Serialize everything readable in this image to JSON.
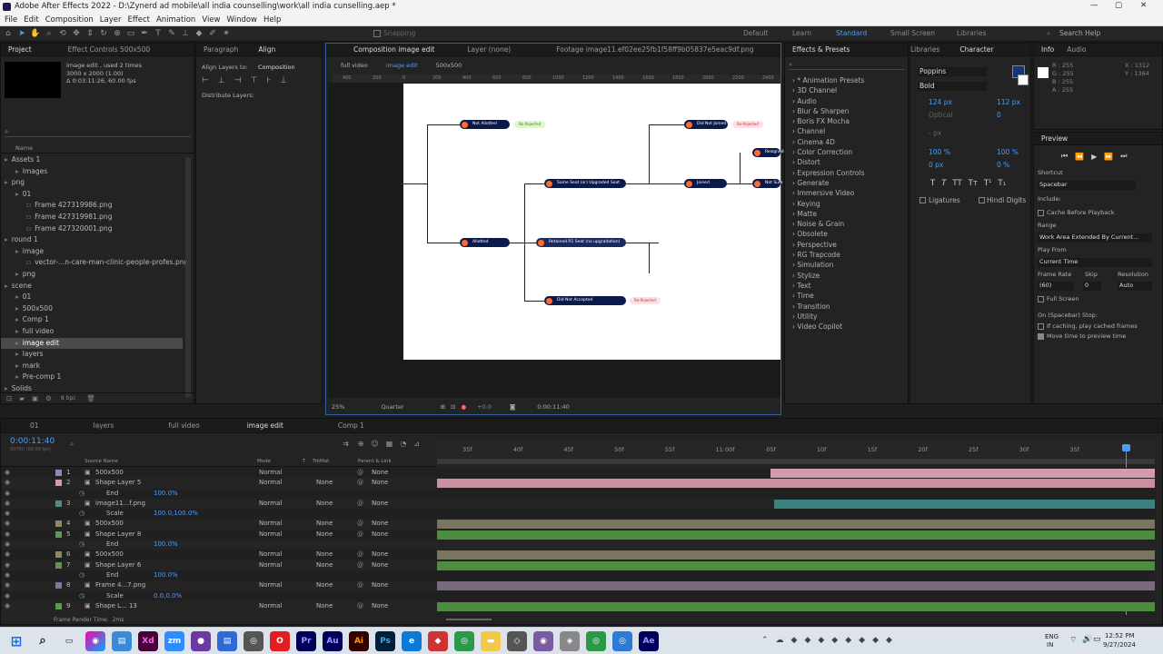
{
  "window": {
    "title": "Adobe After Effects 2022 - D:\\Zynerd ad mobile\\all india counselling\\work\\all india cunselling.aep *"
  },
  "menu": [
    "File",
    "Edit",
    "Composition",
    "Layer",
    "Effect",
    "Animation",
    "View",
    "Window",
    "Help"
  ],
  "toolbar": {
    "snapping": "Snapping",
    "workspaces": [
      "Default",
      "Learn",
      "Standard",
      "Small Screen",
      "Libraries"
    ],
    "search": "Search Help"
  },
  "project": {
    "tabs": [
      "Project",
      "Effect Controls 500x500"
    ],
    "info": [
      "image edit , used 2 times",
      "3000 x 2000 (1.00)",
      "Δ 0:03:11:26, 60.00 fps"
    ],
    "column": "Name",
    "items": [
      {
        "label": "Assets 1",
        "depth": 0
      },
      {
        "label": "Images",
        "depth": 1
      },
      {
        "label": "png",
        "depth": 0
      },
      {
        "label": "01",
        "depth": 1
      },
      {
        "label": "Frame 427319986.png",
        "depth": 2
      },
      {
        "label": "Frame 427319981.png",
        "depth": 2
      },
      {
        "label": "Frame 427320001.png",
        "depth": 2
      },
      {
        "label": "round 1",
        "depth": 0
      },
      {
        "label": "image",
        "depth": 1
      },
      {
        "label": "vector-...n-care-man-clinic-people-profes.png",
        "depth": 2
      },
      {
        "label": "png",
        "depth": 1
      },
      {
        "label": "scene",
        "depth": 0
      },
      {
        "label": "01",
        "depth": 1
      },
      {
        "label": "500x500",
        "depth": 1
      },
      {
        "label": "Comp 1",
        "depth": 1
      },
      {
        "label": "full video",
        "depth": 1
      },
      {
        "label": "image edit",
        "depth": 1,
        "selected": true
      },
      {
        "label": "layers",
        "depth": 1
      },
      {
        "label": "mark",
        "depth": 1
      },
      {
        "label": "Pre-comp 1",
        "depth": 1
      },
      {
        "label": "Solids",
        "depth": 0
      }
    ],
    "bpc": "8 bpc"
  },
  "align": {
    "tabs": [
      "Paragraph",
      "Align"
    ],
    "align_to_label": "Align Layers to:",
    "align_to_value": "Composition",
    "distribute_label": "Distribute Layers:"
  },
  "composition": {
    "tabs": [
      "Composition image edit",
      "Layer (none)",
      "Footage image11.ef02ee25fb1f58ff9b05837e5eac9df.png"
    ],
    "breadcrumbs": [
      "full video",
      "image edit",
      "500x500"
    ],
    "ruler": [
      "400",
      "200",
      "0",
      "200",
      "400",
      "600",
      "800",
      "1000",
      "1200",
      "1400",
      "1600",
      "1800",
      "2000",
      "2200",
      "2400"
    ],
    "zoom": "25%",
    "resolution": "Quarter",
    "exposure": "+0.0",
    "timecode": "0:00:11:40",
    "nodes": [
      "Not Allotted",
      "No Rejected",
      "Did Not Joined",
      "Re-Rejected",
      "Resigned",
      "Not Sure",
      "Joined",
      "Same Seat (or) Upgraded Seat",
      "Allotted",
      "Retained R1 Seat (no upgradation)",
      "Did Not Accepted",
      "Re-Rejected"
    ]
  },
  "effects": {
    "title": "Effects & Presets",
    "items": [
      "* Animation Presets",
      "3D Channel",
      "Audio",
      "Blur & Sharpen",
      "Boris FX Mocha",
      "Channel",
      "Cinema 4D",
      "Color Correction",
      "Distort",
      "Expression Controls",
      "Generate",
      "Immersive Video",
      "Keying",
      "Matte",
      "Noise & Grain",
      "Obsolete",
      "Perspective",
      "RG Trapcode",
      "Simulation",
      "Stylize",
      "Text",
      "Time",
      "Transition",
      "Utility",
      "Video Copilot"
    ]
  },
  "character": {
    "tabs": [
      "Libraries",
      "Character"
    ],
    "font": "Poppins",
    "style": "Bold",
    "size": "124 px",
    "leading": "112 px",
    "tracking": "0",
    "kerning": "Optical",
    "units": "- px",
    "vscale": "100 %",
    "hscale": "100 %",
    "baseline": "0 px",
    "tsume": "0 %",
    "ligatures": "Ligatures",
    "hindi": "Hindi Digits"
  },
  "info": {
    "tabs": [
      "Info",
      "Audio"
    ],
    "rgba": [
      "R : 255",
      "G : 255",
      "B : 255",
      "A : 255"
    ],
    "xy": [
      "X : 1312",
      "Y : 1364"
    ]
  },
  "preview": {
    "title": "Preview",
    "shortcut_label": "Shortcut",
    "shortcut": "Spacebar",
    "include": "Include:",
    "cache": "Cache Before Playback",
    "range_label": "Range",
    "range": "Work Area Extended By Current...",
    "playfrom_label": "Play From",
    "playfrom": "Current Time",
    "fr_label": "Frame Rate",
    "skip_label": "Skip",
    "res_label": "Resolution",
    "fr": "(60)",
    "skip": "0",
    "res": "Auto",
    "fullscreen": "Full Screen",
    "stop": "On (Spacebar) Stop:",
    "ifcaching": "If caching, play cached frames",
    "movetime": "Move time to preview time"
  },
  "timeline": {
    "tabs": [
      "01",
      "layers",
      "full video",
      "image edit",
      "Comp 1"
    ],
    "time": "0:00:11:40",
    "fps": "00700 (60.00 fps)",
    "cols": [
      "Source Name",
      "Mode",
      "T",
      "TrkMat",
      "Parent & Link"
    ],
    "ticks": [
      "35f",
      "40f",
      "45f",
      "50f",
      "55f",
      "11:00f",
      "05f",
      "10f",
      "15f",
      "20f",
      "25f",
      "30f",
      "35f"
    ],
    "layers": [
      {
        "num": "1",
        "name": "500x500",
        "mode": "Normal",
        "trk": "",
        "parent": "None",
        "color": "#8a8ac8",
        "bar": "#d59aae",
        "start": 0.465
      },
      {
        "num": "2",
        "name": "Shape Layer 5",
        "mode": "Normal",
        "trk": "None",
        "parent": "None",
        "color": "#d59aae",
        "bar": "#c9909f",
        "start": 0
      },
      {
        "num": "",
        "name": "End",
        "mode": "",
        "trk": "",
        "parent": "",
        "value": "100.0%",
        "prop": true
      },
      {
        "num": "3",
        "name": "image11...f.png",
        "mode": "Normal",
        "trk": "None",
        "parent": "None",
        "color": "#4c8c8c",
        "bar": "#3d8080",
        "start": 0.47
      },
      {
        "num": "",
        "name": "Scale",
        "mode": "",
        "trk": "",
        "parent": "",
        "value": "100.0,100.0%",
        "prop": true
      },
      {
        "num": "4",
        "name": "500x500",
        "mode": "Normal",
        "trk": "None",
        "parent": "None",
        "color": "#8a8a5a",
        "bar": "#7a7560",
        "start": 0
      },
      {
        "num": "5",
        "name": "Shape Layer 8",
        "mode": "Normal",
        "trk": "None",
        "parent": "None",
        "color": "#5a9a4a",
        "bar": "#4e8c40",
        "start": 0
      },
      {
        "num": "",
        "name": "End",
        "mode": "",
        "trk": "",
        "parent": "",
        "value": "100.0%",
        "prop": true
      },
      {
        "num": "6",
        "name": "500x500",
        "mode": "Normal",
        "trk": "None",
        "parent": "None",
        "color": "#8a8a5a",
        "bar": "#7a7560",
        "start": 0
      },
      {
        "num": "7",
        "name": "Shape Layer 6",
        "mode": "Normal",
        "trk": "None",
        "parent": "None",
        "color": "#5a9a4a",
        "bar": "#4e8c40",
        "start": 0
      },
      {
        "num": "",
        "name": "End",
        "mode": "",
        "trk": "",
        "parent": "",
        "value": "100.0%",
        "prop": true
      },
      {
        "num": "8",
        "name": "Frame 4...7.png",
        "mode": "Normal",
        "trk": "None",
        "parent": "None",
        "color": "#8a70a0",
        "bar": "#7a6a7e",
        "start": 0
      },
      {
        "num": "",
        "name": "Scale",
        "mode": "",
        "trk": "",
        "parent": "",
        "value": "0.0,0.0%",
        "prop": true
      },
      {
        "num": "9",
        "name": "Shape L... 13",
        "mode": "Normal",
        "trk": "None",
        "parent": "None",
        "color": "#5a9a4a",
        "bar": "#4e8c40",
        "start": 0
      }
    ],
    "render_label": "Frame Render Time:",
    "render": "2ms"
  },
  "taskbar": {
    "time": "12:52 PM",
    "date": "9/27/2024",
    "lang": "ENG",
    "region": "IN",
    "apps": [
      "search",
      "taskview",
      "copilot",
      "store",
      "xd",
      "zoom",
      "tor",
      "chrome-doc",
      "photoshop-cc",
      "opera",
      "premiere",
      "audition",
      "illustrator",
      "photoshop",
      "edge-blue",
      "chrome",
      "files",
      "aftereffects-2",
      "chrome2",
      "chrome3",
      "explorer2",
      "ae"
    ]
  }
}
